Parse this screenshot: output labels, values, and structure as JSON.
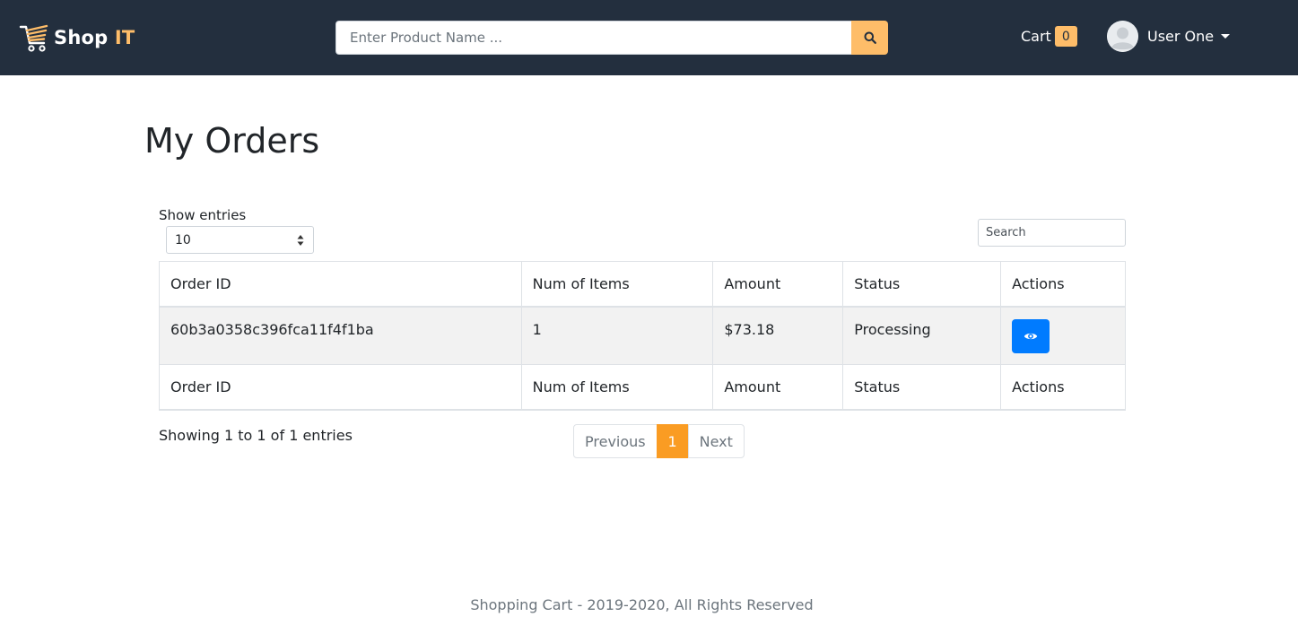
{
  "navbar": {
    "brand_shop": "Shop",
    "brand_it": "IT",
    "search_placeholder": "Enter Product Name ...",
    "cart_label": "Cart",
    "cart_count": "0",
    "user_name": "User One"
  },
  "main": {
    "title": "My Orders",
    "show_entries_label": "Show entries",
    "entries_value": "10",
    "search_placeholder": "Search",
    "columns": [
      "Order ID",
      "Num of Items",
      "Amount",
      "Status",
      "Actions"
    ],
    "rows": [
      {
        "order_id": "60b3a0358c396fca11f4f1ba",
        "num_items": "1",
        "amount": "$73.18",
        "status": "Processing"
      }
    ],
    "showing_info": "Showing 1 to 1 of 1 entries",
    "pagination": {
      "previous": "Previous",
      "current": "1",
      "next": "Next"
    }
  },
  "footer": {
    "text": "Shopping Cart - 2019-2020, All Rights Reserved"
  },
  "colors": {
    "navbar_bg": "#232f3e",
    "accent": "#febd69",
    "active_page": "#fa9c23",
    "view_button": "#007bff",
    "status_processing": "#dc3545"
  },
  "icons": {
    "logo": "shopping-cart-logo-icon",
    "search": "search-icon",
    "avatar": "user-avatar-icon",
    "view": "eye-icon"
  }
}
